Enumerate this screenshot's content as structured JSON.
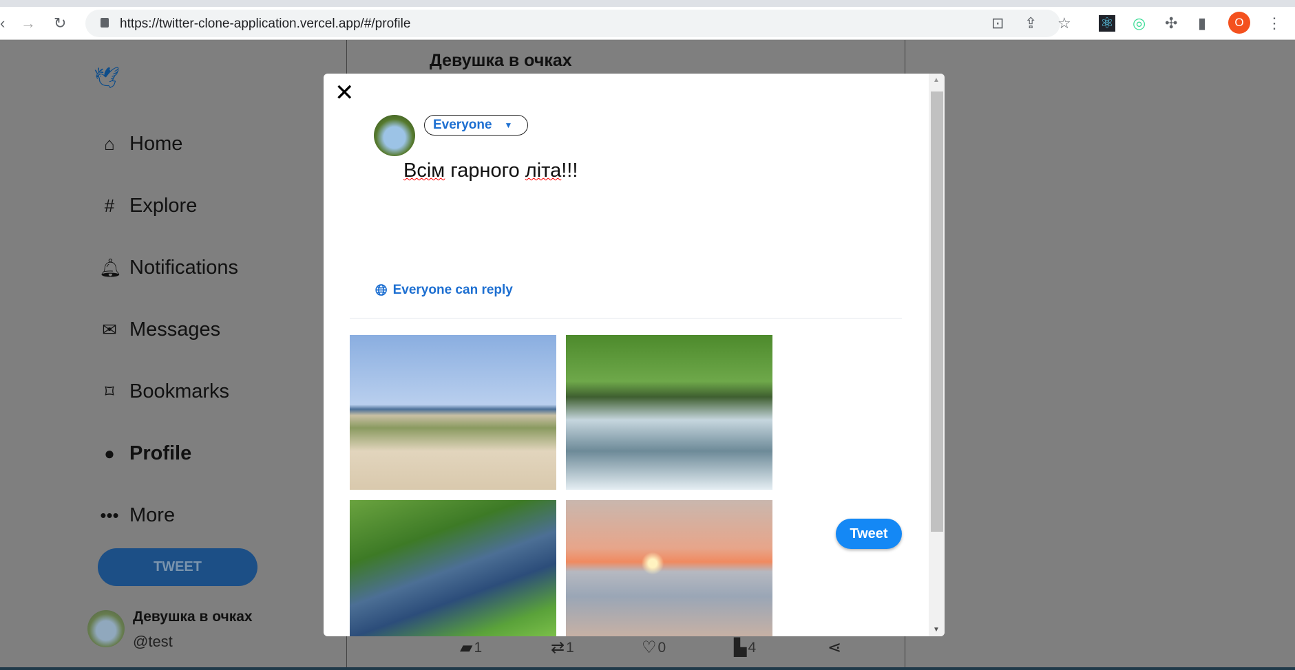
{
  "browser": {
    "url": "https://twitter-clone-application.vercel.app/#/profile",
    "profile_initial": "O"
  },
  "sidebar": {
    "items": [
      {
        "label": "Home",
        "icon": "home-icon"
      },
      {
        "label": "Explore",
        "icon": "hash-icon"
      },
      {
        "label": "Notifications",
        "icon": "bell-icon"
      },
      {
        "label": "Messages",
        "icon": "mail-icon"
      },
      {
        "label": "Bookmarks",
        "icon": "bookmark-icon"
      },
      {
        "label": "Profile",
        "icon": "person-icon"
      },
      {
        "label": "More",
        "icon": "more-icon"
      }
    ],
    "tweet_label": "TWEET",
    "user": {
      "name": "Девушка в очках",
      "handle": "@test"
    }
  },
  "header": {
    "title": "Девушка в очках"
  },
  "actions": {
    "comments": "1",
    "retweets": "1",
    "likes": "0",
    "views": "4"
  },
  "modal": {
    "audience": "Everyone",
    "text_parts": [
      "Всім",
      "гарного",
      "літа",
      "!!!"
    ],
    "reply_setting": "Everyone can reply",
    "tweet_label": "Tweet",
    "images": [
      "beach dunes",
      "river with willow",
      "green river",
      "sunset over sea"
    ]
  },
  "colors": {
    "accent": "#1d6fd1",
    "tweet_button": "#1488f5",
    "overlay": "#7f7f7f"
  }
}
